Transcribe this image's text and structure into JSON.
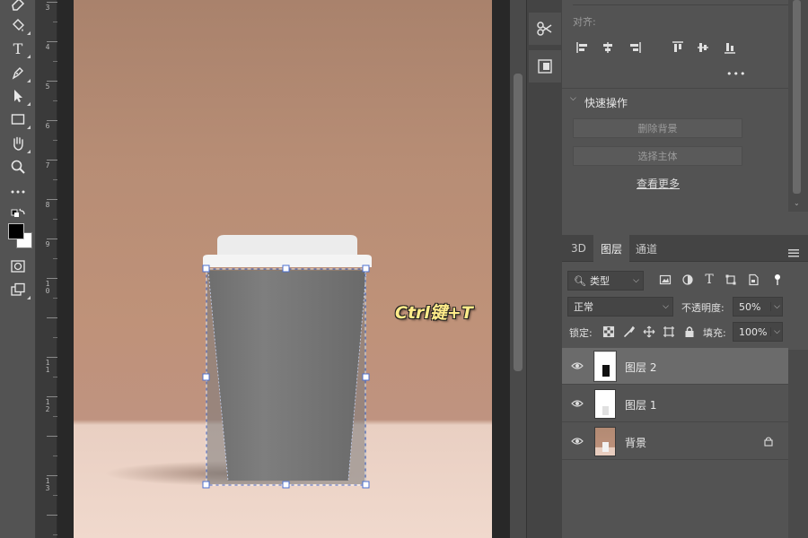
{
  "canvas": {
    "annotation": "Ctrl键+T"
  },
  "ruler": {
    "labels": [
      "3",
      "4",
      "5",
      "6",
      "7",
      "8",
      "9",
      "1 0",
      "1 1",
      "1 2",
      "1 3"
    ]
  },
  "properties": {
    "align_label": "对齐:",
    "more": "•••",
    "quick_actions": "快速操作",
    "remove_bg": "删除背景",
    "select_subject": "选择主体",
    "see_more": "查看更多"
  },
  "layers_panel": {
    "tabs": [
      "3D",
      "图层",
      "通道"
    ],
    "filter_label": "类型",
    "blend_mode": "正常",
    "opacity_label": "不透明度:",
    "opacity_value": "50%",
    "lock_label": "锁定:",
    "fill_label": "填充:",
    "fill_value": "100%",
    "layers": [
      {
        "name": "图层 2",
        "selected": true
      },
      {
        "name": "图层 1",
        "selected": false
      },
      {
        "name": "背景",
        "selected": false,
        "locked": true
      }
    ]
  },
  "colors": {
    "accent_annotation": "#ffec8a",
    "transform_handle": "#5b7bd5",
    "panel_bg": "#535353"
  },
  "icons": {
    "toolbar": [
      "eraser-icon",
      "paint-bucket-icon",
      "type-icon",
      "pen-icon",
      "move-icon",
      "rectangle-icon",
      "hand-icon",
      "zoom-icon",
      "more-icon",
      "swap-colors-icon",
      "quick-mask-icon",
      "screen-mode-icon"
    ]
  }
}
